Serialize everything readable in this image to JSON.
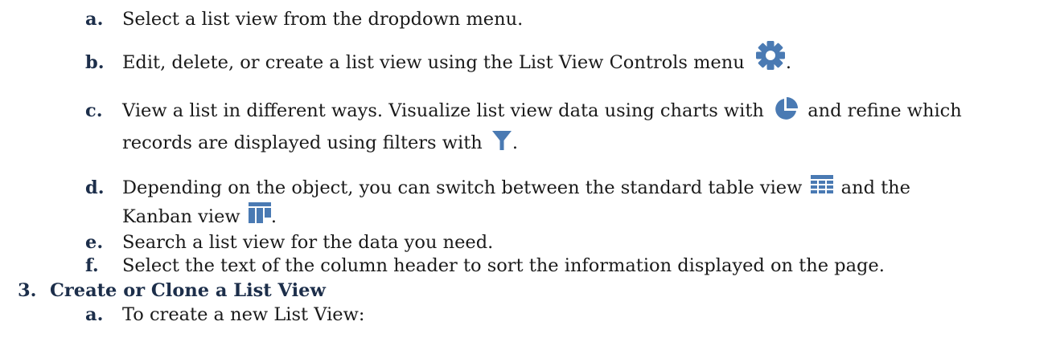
{
  "list_items": [
    {
      "letter": "a.",
      "text": "Select a list view from the dropdown menu."
    },
    {
      "letter": "b.",
      "text_1": "Edit, delete, or create a list view using the List View Controls menu",
      "text_2": ".",
      "icon": "gear-icon"
    },
    {
      "letter": "c.",
      "text_1": "View a list in different ways. Visualize list view data using charts with",
      "text_2": "and refine which",
      "text_3": "records are displayed using filters with",
      "text_4": ".",
      "icons": [
        "pie-chart-icon",
        "filter-icon"
      ]
    },
    {
      "letter": "d.",
      "text_1": "Depending on the object, you can switch between the standard table view",
      "text_2": "and the",
      "text_3": "Kanban view",
      "text_4": ".",
      "icons": [
        "table-view-icon",
        "kanban-view-icon"
      ]
    },
    {
      "letter": "e.",
      "text": "Search a list view for the data you need."
    },
    {
      "letter": "f.",
      "text": "Select the text of the column header to sort the information displayed on the page."
    }
  ],
  "section": {
    "number": "3.",
    "title": "Create or Clone a List View"
  },
  "sub_items": [
    {
      "letter": "a.",
      "text": "To create a new List View:"
    }
  ],
  "colors": {
    "icon": "#4a7ab3",
    "heading": "#1c2e4a",
    "text": "#1a1a1a"
  }
}
